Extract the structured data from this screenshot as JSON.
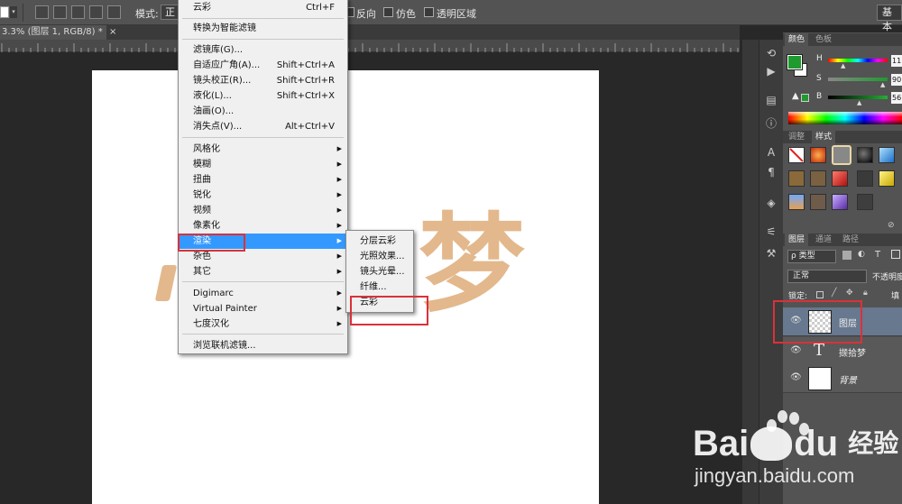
{
  "options_bar": {
    "mode_label": "模式:",
    "mode_value": "正",
    "reverse_label": "反向",
    "dither_label": "仿色",
    "transparency_label": "透明区域",
    "workspace_label": "基本"
  },
  "document_tab": {
    "title": "3.3% (图层 1, RGB/8) *",
    "close": "×"
  },
  "canvas": {
    "text_visible": "梦"
  },
  "filter_menu": {
    "items": [
      {
        "label": "云彩",
        "shortcut": "Ctrl+F"
      },
      {
        "label": "转换为智能滤镜",
        "shortcut": ""
      },
      {
        "label": "滤镜库(G)...",
        "shortcut": ""
      },
      {
        "label": "自适应广角(A)...",
        "shortcut": "Shift+Ctrl+A"
      },
      {
        "label": "镜头校正(R)...",
        "shortcut": "Shift+Ctrl+R"
      },
      {
        "label": "液化(L)...",
        "shortcut": "Shift+Ctrl+X"
      },
      {
        "label": "油画(O)...",
        "shortcut": ""
      },
      {
        "label": "消失点(V)...",
        "shortcut": "Alt+Ctrl+V"
      },
      {
        "label": "风格化",
        "shortcut": ""
      },
      {
        "label": "模糊",
        "shortcut": ""
      },
      {
        "label": "扭曲",
        "shortcut": ""
      },
      {
        "label": "锐化",
        "shortcut": ""
      },
      {
        "label": "视频",
        "shortcut": ""
      },
      {
        "label": "像素化",
        "shortcut": ""
      },
      {
        "label": "渲染",
        "shortcut": ""
      },
      {
        "label": "杂色",
        "shortcut": ""
      },
      {
        "label": "其它",
        "shortcut": ""
      },
      {
        "label": "Digimarc",
        "shortcut": ""
      },
      {
        "label": "Virtual Painter",
        "shortcut": ""
      },
      {
        "label": "七度汉化",
        "shortcut": ""
      },
      {
        "label": "浏览联机滤镜...",
        "shortcut": ""
      }
    ]
  },
  "render_submenu": {
    "items": [
      "分层云彩",
      "光照效果...",
      "镜头光晕...",
      "纤维...",
      "云彩"
    ]
  },
  "color_panel": {
    "tabs": [
      "颜色",
      "色板"
    ],
    "h_label": "H",
    "s_label": "S",
    "b_label": "B",
    "h_value": "11",
    "s_value": "90",
    "b_value": "56",
    "foreground_color": "#1f9a2e"
  },
  "adjust_panel": {
    "tabs": [
      "调整",
      "样式"
    ]
  },
  "layers_panel": {
    "tabs": [
      "图层",
      "通道",
      "路径"
    ],
    "filter_label": "ρ 类型",
    "blend_mode": "正常",
    "opacity_label": "不透明度",
    "lock_label": "锁定:",
    "fill_label": "填",
    "layers": [
      {
        "name": "图层",
        "type": "pixel"
      },
      {
        "name": "撷拾梦",
        "type": "text"
      },
      {
        "name": "背景",
        "type": "background"
      }
    ]
  },
  "watermark": {
    "brand": "Bai",
    "brand2": "du",
    "product": "经验",
    "url": "jingyan.baidu.com"
  }
}
